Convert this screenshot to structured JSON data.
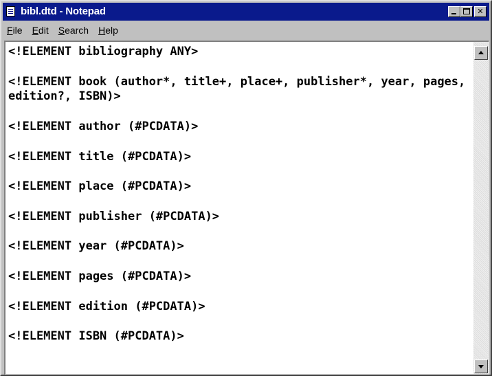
{
  "window": {
    "title": "bibl.dtd - Notepad",
    "controls": {
      "minimize_icon": "minimize-icon",
      "maximize_icon": "maximize-icon",
      "close_label": "✕"
    }
  },
  "menu": {
    "items": [
      {
        "accel": "F",
        "rest": "ile"
      },
      {
        "accel": "E",
        "rest": "dit"
      },
      {
        "accel": "S",
        "rest": "earch"
      },
      {
        "accel": "H",
        "rest": "elp"
      }
    ]
  },
  "editor": {
    "lines": [
      "<!ELEMENT bibliography ANY>",
      "",
      "<!ELEMENT book (author*, title+, place+, publisher*, year, pages, edition?, ISBN)>",
      "",
      "<!ELEMENT author (#PCDATA)>",
      "",
      "<!ELEMENT title (#PCDATA)>",
      "",
      "<!ELEMENT place (#PCDATA)>",
      "",
      "<!ELEMENT publisher (#PCDATA)>",
      "",
      "<!ELEMENT year (#PCDATA)>",
      "",
      "<!ELEMENT pages (#PCDATA)>",
      "",
      "<!ELEMENT edition (#PCDATA)>",
      "",
      "<!ELEMENT ISBN (#PCDATA)>"
    ]
  },
  "colors": {
    "titlebar": "#0a1a8c",
    "chrome": "#c0c0c0",
    "editor_bg": "#ffffff"
  }
}
